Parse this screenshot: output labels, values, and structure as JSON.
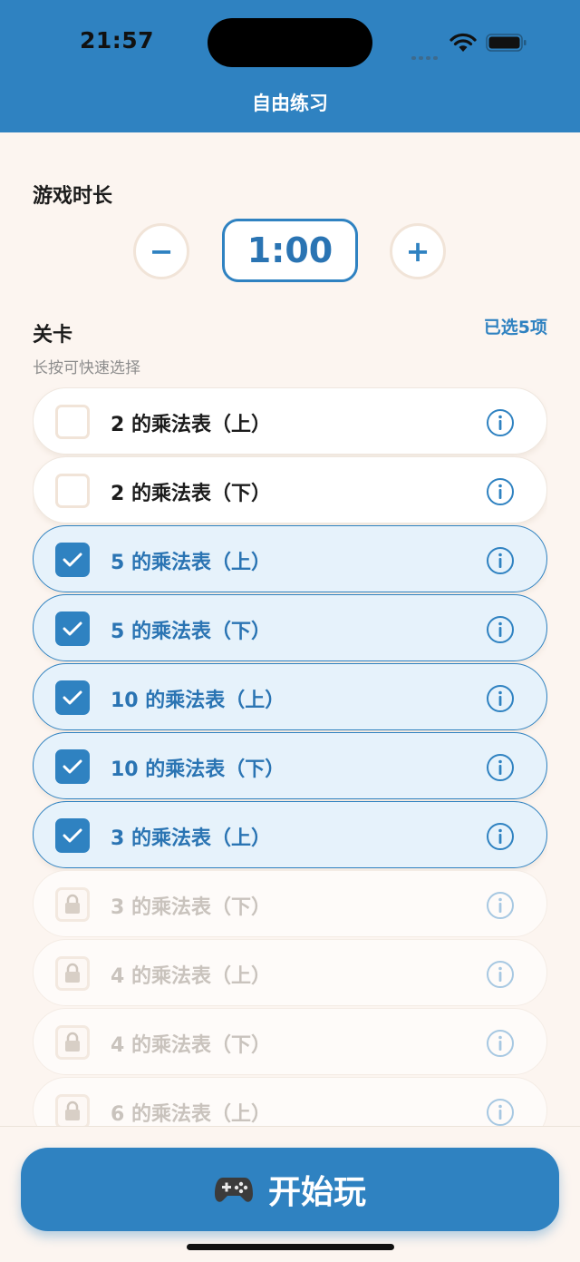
{
  "status_bar": {
    "time": "21:57"
  },
  "header": {
    "title": "自由练习"
  },
  "duration": {
    "title": "游戏时长",
    "value": "1:00",
    "decrease_label": "−",
    "increase_label": "+"
  },
  "levels": {
    "title": "关卡",
    "selected_count": "已选5项",
    "hint": "长按可快速选择",
    "items": [
      {
        "label": "2 的乘法表（上）",
        "state": "unchecked"
      },
      {
        "label": "2 的乘法表（下）",
        "state": "unchecked"
      },
      {
        "label": "5 的乘法表（上）",
        "state": "checked"
      },
      {
        "label": "5 的乘法表（下）",
        "state": "checked"
      },
      {
        "label": "10 的乘法表（上）",
        "state": "checked"
      },
      {
        "label": "10 的乘法表（下）",
        "state": "checked"
      },
      {
        "label": "3 的乘法表（上）",
        "state": "checked"
      },
      {
        "label": "3 的乘法表（下）",
        "state": "locked"
      },
      {
        "label": "4 的乘法表（上）",
        "state": "locked"
      },
      {
        "label": "4 的乘法表（下）",
        "state": "locked"
      },
      {
        "label": "6 的乘法表（上）",
        "state": "locked"
      }
    ]
  },
  "play_button": {
    "label": "开始玩",
    "icon": "gamepad-icon"
  },
  "colors": {
    "primary": "#2f82c1",
    "background": "#fcf5f0",
    "checked_bg": "#e6f2fb"
  }
}
